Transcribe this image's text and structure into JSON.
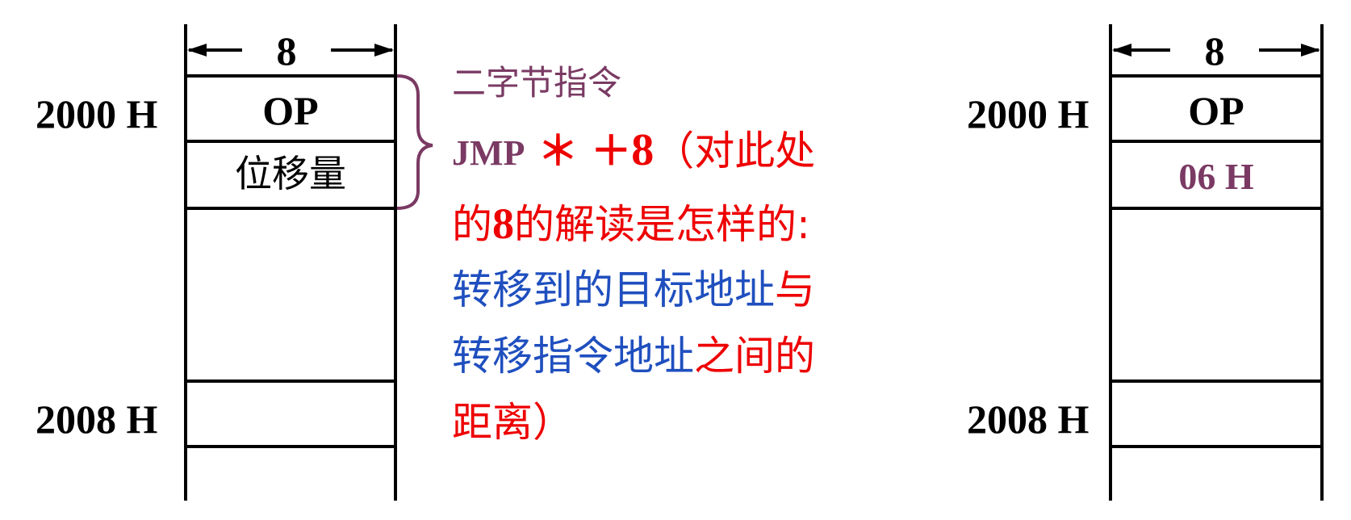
{
  "left_memory": {
    "width_label": "8",
    "address_top": "2000 H",
    "address_bottom": "2008 H",
    "cell_opcode": "OP",
    "cell_displacement": "位移量"
  },
  "annotation": {
    "title": "二字节指令",
    "instr_name": "JMP",
    "instr_star": "＊",
    "instr_plus": "＋",
    "instr_eight": "8",
    "instr_tail": "（对此处",
    "line2_a": "的",
    "line2_num": "8",
    "line2_b": "的解读是怎样的:",
    "line3_blue": "转移到的目标地址",
    "line3_red": "与",
    "line4_blue": "转移指令地址",
    "line4_red": "之间的",
    "line5": "距离）"
  },
  "right_memory": {
    "width_label": "8",
    "address_top": "2000 H",
    "address_bottom": "2008 H",
    "cell_opcode": "OP",
    "cell_displacement": "06 H"
  },
  "colors": {
    "purple": "#7a3a63",
    "red": "#ee0000",
    "blue": "#1f4fbf",
    "black": "#000000"
  }
}
